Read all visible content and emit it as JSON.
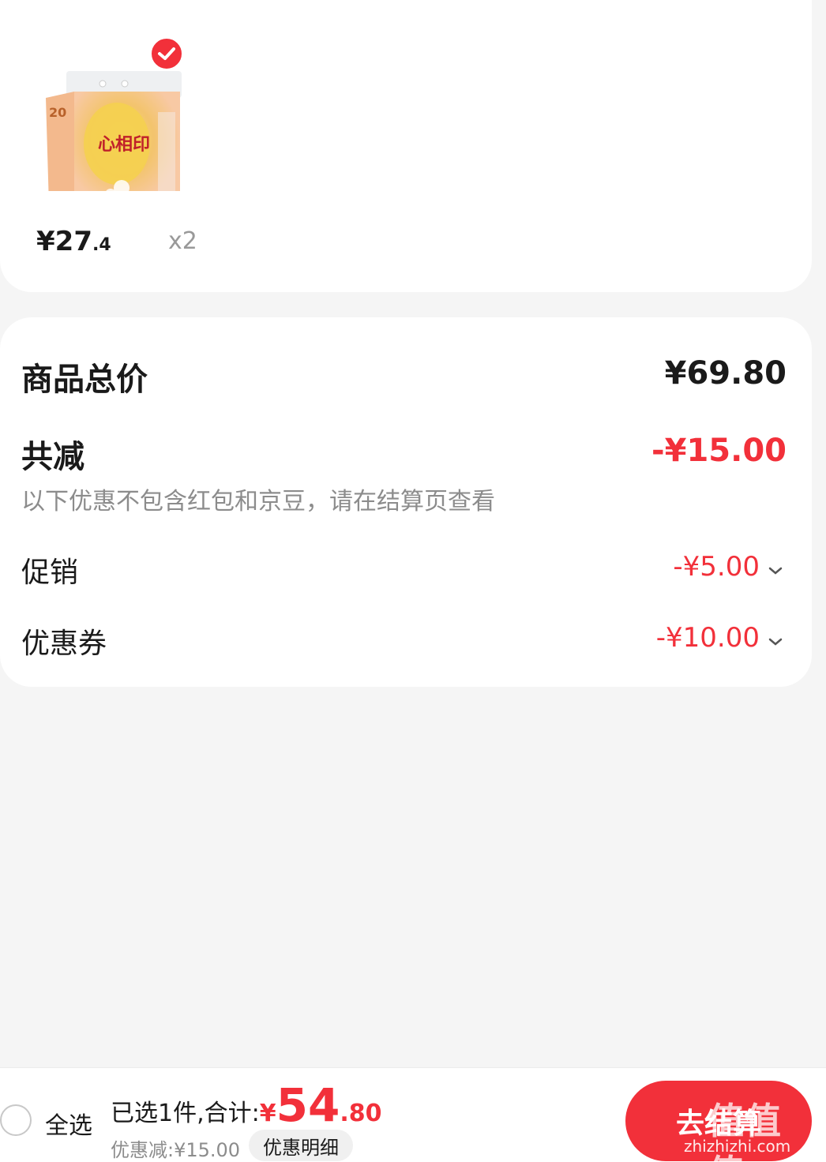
{
  "product": {
    "price_symbol": "¥",
    "price_integer": "27",
    "price_decimal": ".4",
    "quantity": "x2",
    "selected": true,
    "image_icon": "tissue-pack-icon",
    "pack_count_label": "20"
  },
  "summary": {
    "total_label": "商品总价",
    "total_value": "¥69.80",
    "discount_label": "共减",
    "discount_value": "-¥15.00",
    "note": "以下优惠不包含红包和京豆，请在结算页查看",
    "promo_label": "促销",
    "promo_value": "-¥5.00",
    "coupon_label": "优惠券",
    "coupon_value": "-¥10.00"
  },
  "bottom_bar": {
    "select_all_label": "全选",
    "selected_text": "已选1件,合计:",
    "total_yen": "¥",
    "total_integer": "54",
    "total_decimal": ".80",
    "saved_text": "优惠减:¥15.00",
    "detail_button": "优惠明细",
    "checkout_button": "去结算"
  },
  "watermark": {
    "title": "值值值",
    "domain": "zhizhizhi.com"
  },
  "colors": {
    "accent_red": "#f2303a",
    "background": "#f5f5f5",
    "muted_text": "#8c8c8c"
  }
}
